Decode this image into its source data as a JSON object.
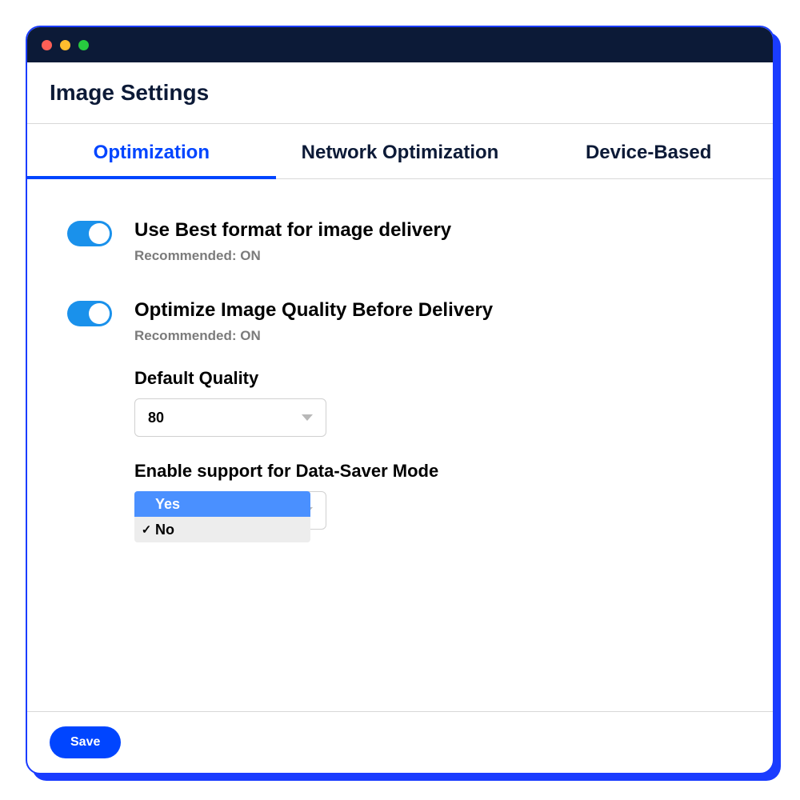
{
  "header": {
    "title": "Image Settings"
  },
  "tabs": {
    "items": [
      {
        "label": "Optimization"
      },
      {
        "label": "Network Optimization"
      },
      {
        "label": "Device-Based"
      }
    ]
  },
  "settings": {
    "best_format": {
      "title": "Use Best format for image delivery",
      "subtitle": "Recommended: ON",
      "on": true
    },
    "optimize_quality": {
      "title": "Optimize Image Quality Before Delivery",
      "subtitle": "Recommended: ON",
      "on": true,
      "default_quality": {
        "label": "Default Quality",
        "value": "80"
      },
      "data_saver": {
        "label": "Enable support for Data-Saver Mode",
        "options": [
          {
            "label": "Yes",
            "highlighted": true,
            "checked": false
          },
          {
            "label": "No",
            "highlighted": false,
            "checked": true
          }
        ]
      }
    }
  },
  "footer": {
    "save_label": "Save"
  }
}
